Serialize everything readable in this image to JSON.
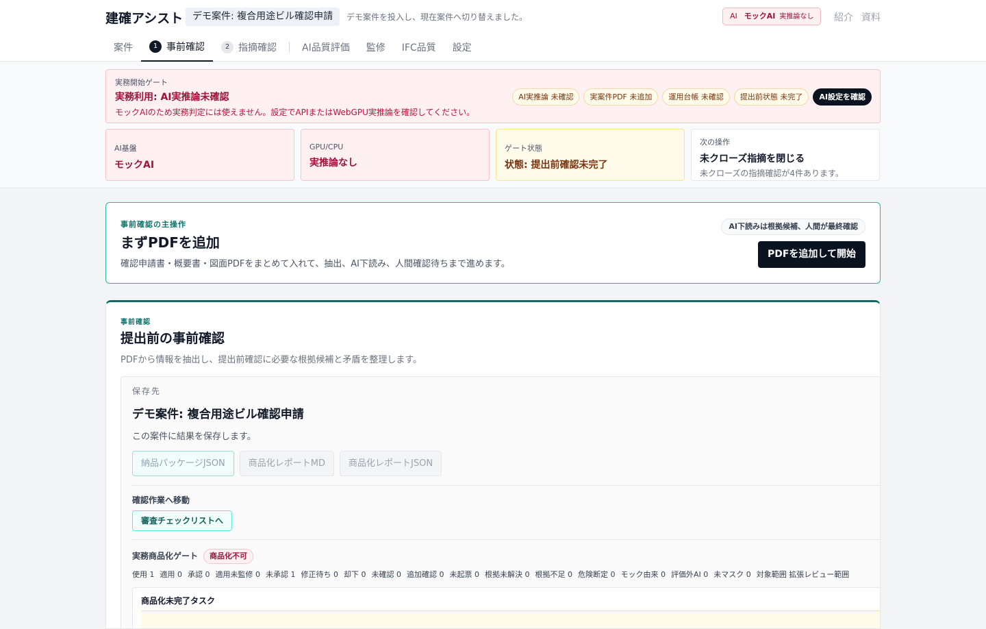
{
  "header": {
    "brand": "建確アシスト",
    "case_pill": "デモ案件: 複合用途ビル確認申請",
    "message": "デモ案件を投入し、現在案件へ切り替えました。",
    "ai_badge": {
      "key": "AI",
      "value": "モックAI",
      "status": "実推論なし"
    },
    "links": [
      "紹介",
      "資料"
    ]
  },
  "tabs": [
    {
      "label": "案件"
    },
    {
      "label": "事前確認",
      "num": "1",
      "active": true
    },
    {
      "label": "指摘確認",
      "num": "2"
    },
    {
      "label": "AI品質評価"
    },
    {
      "label": "監修"
    },
    {
      "label": "IFC品質"
    },
    {
      "label": "設定"
    }
  ],
  "gate": {
    "label": "実務開始ゲート",
    "title": "実務利用: AI実推論未確認",
    "description": "モックAIのため実務判定には使えません。設定でAPIまたはWebGPU実推論を確認してください。",
    "chips": [
      "AI実推論 未確認",
      "実案件PDF 未追加",
      "運用台帳 未確認",
      "提出前状態 未完了"
    ],
    "action": "AI設定を確認"
  },
  "status_cards": [
    {
      "label": "AI基盤",
      "value": "モックAI"
    },
    {
      "label": "GPU/CPU",
      "value": "実推論なし"
    },
    {
      "label": "ゲート状態",
      "value": "状態: 提出前確認未完了"
    },
    {
      "label": "次の操作",
      "value": "未クローズ指摘を閉じる",
      "detail": "未クローズの指摘確認が4件あります。"
    }
  ],
  "primary": {
    "eyebrow": "事前確認の主操作",
    "title": "まずPDFを追加",
    "description": "確認申請書・概要書・図面PDFをまとめて入れて、抽出、AI下読み、人間確認待ちまで進めます。",
    "hint": "AI下読みは根拠候補、人間が最終確認",
    "button": "PDFを追加して開始"
  },
  "section": {
    "eyebrow": "事前確認",
    "title": "提出前の事前確認",
    "description": "PDFから情報を抽出し、提出前確認に必要な根拠候補と矛盾を整理します。",
    "save_label": "保存先",
    "case_name": "デモ案件: 複合用途ビル確認申請",
    "save_note": "この案件に結果を保存します。",
    "exports": [
      "納品パッケージJSON",
      "商品化レポートMD",
      "商品化レポートJSON"
    ],
    "move_label": "確認作業へ移動",
    "move_button": "審査チェックリストへ",
    "gate_label": "実務商品化ゲート",
    "gate_status": "商品化不可",
    "stats": [
      "使用 1",
      "適用 0",
      "承認 0",
      "適用未監修 0",
      "未承認 1",
      "修正待ち 0",
      "却下 0",
      "未確認 0",
      "追加確認 0",
      "未起票 0",
      "根拠未解決 0",
      "根拠不足 0",
      "危険断定 0",
      "モック由来 0",
      "評価外AI 0",
      "未マスク 0",
      "対象範囲 拡張レビュー範囲"
    ],
    "tasks_title": "商品化未完了タスク"
  }
}
